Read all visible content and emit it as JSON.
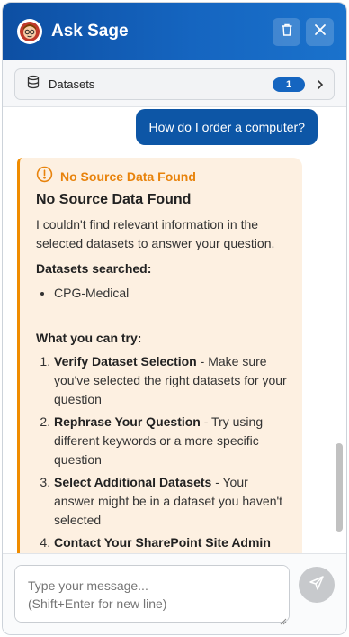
{
  "header": {
    "title": "Ask Sage",
    "avatar_icon": "sage-avatar-icon",
    "delete_icon": "trash-icon",
    "close_icon": "close-icon"
  },
  "datasets_bar": {
    "icon": "database-icon",
    "label": "Datasets",
    "count": "1",
    "chevron_icon": "chevron-right-icon"
  },
  "conversation": {
    "user_message": "How do I order a computer?",
    "bot_response": {
      "warning_title": "No Source Data Found",
      "heading": "No Source Data Found",
      "intro": "I couldn't find relevant information in the selected datasets to answer your question.",
      "searched_label": "Datasets searched:",
      "datasets": [
        "CPG-Medical"
      ],
      "try_label": "What you can try:",
      "suggestions": [
        {
          "title": "Verify Dataset Selection",
          "text": " - Make sure you've selected the right datasets for your question"
        },
        {
          "title": "Rephrase Your Question",
          "text": " - Try using different keywords or a more specific question"
        },
        {
          "title": "Select Additional Datasets",
          "text": " - Your answer might be in a dataset you haven't selected"
        },
        {
          "title": "Contact Your SharePoint Site Admin",
          "text": ""
        }
      ]
    }
  },
  "composer": {
    "placeholder": "Type your message...\n(Shift+Enter for new line)",
    "send_icon": "send-icon"
  },
  "colors": {
    "header_blue": "#1565c0",
    "user_bubble": "#0d56a6",
    "warning_orange": "#f08c00",
    "bot_card_bg": "#fdf0e1"
  }
}
